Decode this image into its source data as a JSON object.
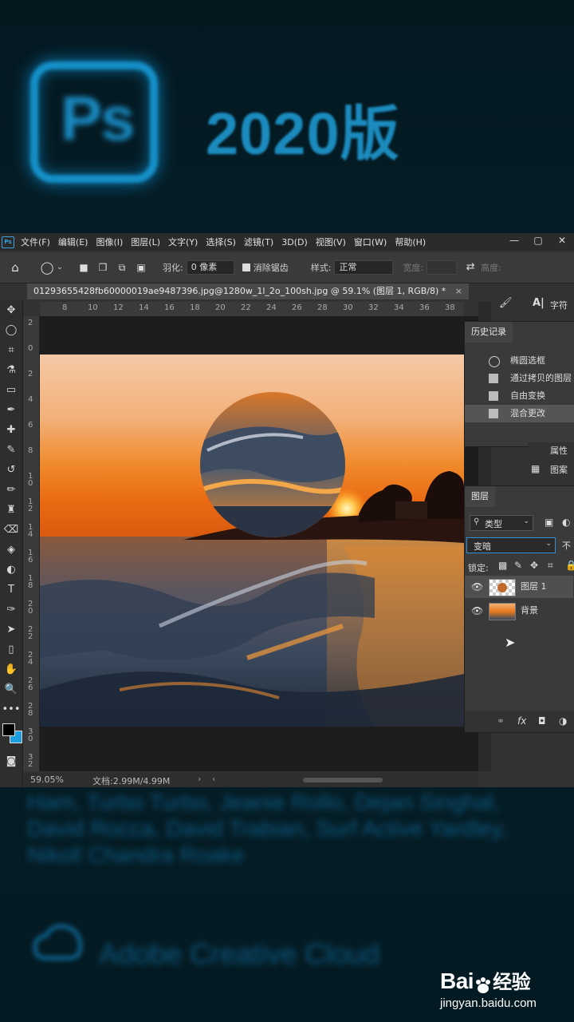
{
  "hero": {
    "logo_text": "Ps",
    "title": "2020版"
  },
  "menu": {
    "items": [
      "文件(F)",
      "编辑(E)",
      "图像(I)",
      "图层(L)",
      "文字(Y)",
      "选择(S)",
      "滤镜(T)",
      "3D(D)",
      "视图(V)",
      "窗口(W)",
      "帮助(H)"
    ],
    "window_controls": [
      "—",
      "▢",
      "✕"
    ]
  },
  "options": {
    "feather_label": "羽化:",
    "feather_value": "0 像素",
    "antialias_label": "消除锯齿",
    "style_label": "样式:",
    "style_value": "正常",
    "width_label": "宽度:",
    "height_label": "高度:"
  },
  "document": {
    "tab_title": "01293655428fb60000019ae9487396.jpg@1280w_1l_2o_100sh.jpg @ 59.1% (图层 1, RGB/8) *",
    "tab_close": "×"
  },
  "rulers": {
    "top": [
      "8",
      "10",
      "12",
      "14",
      "16",
      "18",
      "20",
      "22",
      "24",
      "26",
      "28",
      "30",
      "32",
      "34",
      "36",
      "38"
    ],
    "left": [
      "2",
      "0",
      "2",
      "4",
      "6",
      "8",
      "1\n0",
      "1\n2",
      "1\n4",
      "1\n6",
      "1\n8",
      "2\n0",
      "2\n2",
      "2\n4",
      "2\n6",
      "2\n8",
      "3\n0",
      "3\n2"
    ]
  },
  "tools": [
    "move-icon",
    "marquee-icon",
    "crop-icon",
    "eyedropper-icon",
    "frame-icon",
    "healing-icon",
    "brush-icon",
    "stamp-icon",
    "history-brush-icon",
    "eraser-icon",
    "gradient-icon",
    "blur-icon",
    "dodge-icon",
    "pen-icon",
    "type-icon",
    "path-select-icon",
    "rect-shape-icon",
    "hand-icon",
    "zoom-icon",
    "more-icon"
  ],
  "type_tool_glyph": "T",
  "status": {
    "zoom": "59.05%",
    "doc_size": "文档:2.99M/4.99M"
  },
  "panels": {
    "char_label": "字符",
    "history": {
      "title": "历史记录",
      "items": [
        {
          "icon": "ellipse-icon",
          "label": "椭圆选框"
        },
        {
          "icon": "doc-icon",
          "label": "通过拷贝的图层"
        },
        {
          "icon": "doc-icon",
          "label": "自由变换"
        },
        {
          "icon": "doc-icon",
          "label": "混合更改"
        }
      ]
    },
    "side_items": [
      "属性",
      "图案"
    ],
    "layers": {
      "title": "图层",
      "filter_value": "类型",
      "blend_mode": "变暗",
      "opacity_label": "不",
      "lock_label": "锁定:",
      "items": [
        {
          "name": "图层 1",
          "selected": true
        },
        {
          "name": "背景",
          "selected": false
        }
      ],
      "footer_icons": [
        "link-icon",
        "fx-icon",
        "mask-icon",
        "adjust-icon"
      ],
      "fx_label": "fx"
    }
  },
  "credits_text": "Ham, Turbo Turbo, Jeanie Rollo, Dejan Singhal, David Rocca, David Trabian, Surf Active Yardley, Nikoll Chandra Roake",
  "cc_text": "Adobe Creative Cloud",
  "watermark": {
    "brand": "Bai",
    "brand2": "经验",
    "domain": "jingyan.baidu.com"
  },
  "colors": {
    "accent": "#1590c8",
    "ps_bg": "#323232",
    "foreground_swatch": "#000000",
    "background_swatch": "#1a9ee0"
  }
}
